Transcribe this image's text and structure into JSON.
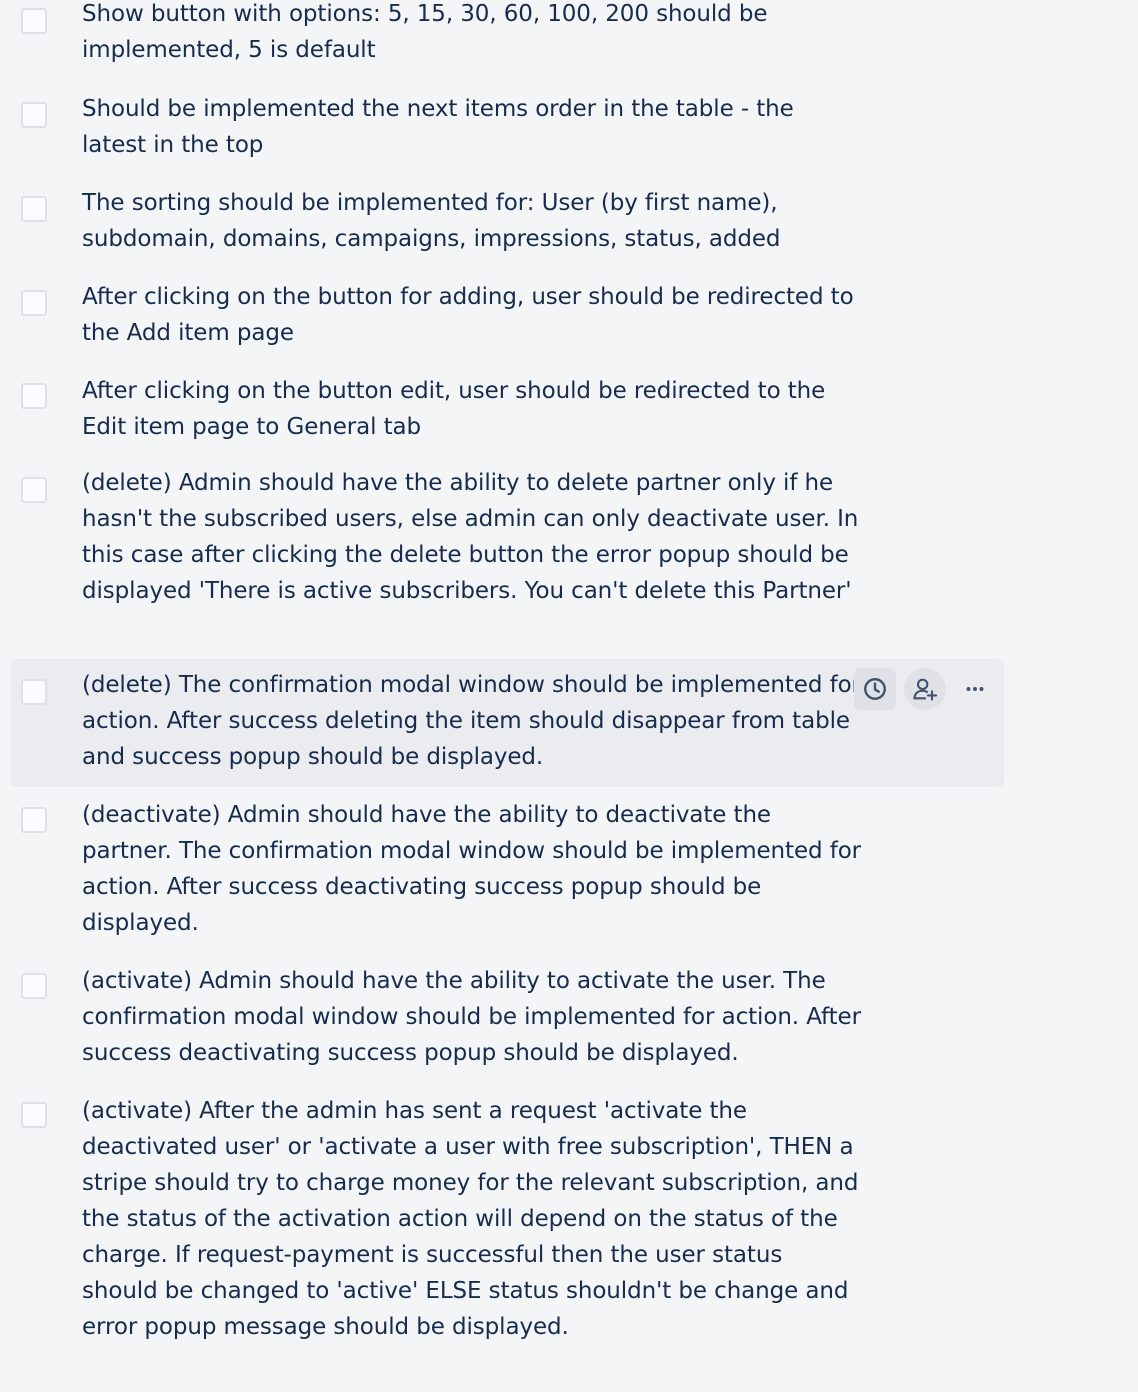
{
  "checklist": {
    "items": [
      {
        "text": "Show button with options: 5, 15, 30, 60, 100, 200 should be implemented, 5 is default",
        "checked": false
      },
      {
        "text": "Should be implemented the next items order in the table - the latest in the top",
        "checked": false
      },
      {
        "text": "The sorting should be implemented for: User (by first name), subdomain, domains, campaigns, impressions, status, added",
        "checked": false
      },
      {
        "text": "After clicking on the button for adding, user should be redirected to the Add item page",
        "checked": false
      },
      {
        "text": "After clicking on the button edit, user should be redirected to the Edit item page to General tab",
        "checked": false
      },
      {
        "text": "(delete) Admin should have the ability to delete partner only if he hasn't the subscribed users, else admin can only deactivate user. In this case after clicking the delete button the error popup should be displayed 'There is active subscribers. You can't delete this Partner'",
        "checked": false
      },
      {
        "text": "(delete) The confirmation modal window should be implemented for action. After success deleting the item should disappear from table and success popup should be displayed.",
        "checked": false
      },
      {
        "text": "(deactivate) Admin should have the ability to deactivate the partner. The confirmation modal window should be implemented for action. After success deactivating success popup should be displayed.",
        "checked": false
      },
      {
        "text": "(activate) Admin should have the ability to activate the user. The confirmation modal window should be implemented for action. After success deactivating success popup should be displayed.",
        "checked": false
      },
      {
        "text": "(activate) After the admin has sent a request 'activate the deactivated user' or 'activate a user with free subscription', THEN a stripe should try to charge money for the relevant subscription, and the status of the activation action will depend on the status of the charge. If request-payment is successful then the user status should be changed to 'active' ELSE status shouldn't be change and error popup message should be displayed.",
        "checked": false
      }
    ],
    "hover_actions": {
      "icons": [
        "clock-icon",
        "add-person-icon",
        "more-icon"
      ]
    }
  },
  "colors": {
    "background": "#f4f5f7",
    "hover_row": "#ebecf0",
    "text": "#172b4d",
    "icon": "#42526e",
    "checkbox_border": "#dfe1e6"
  }
}
